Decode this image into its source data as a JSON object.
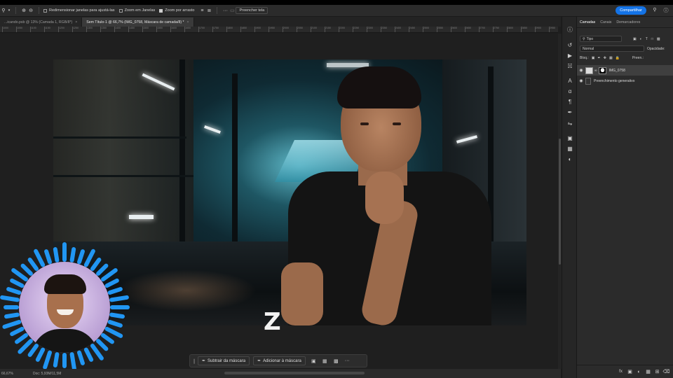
{
  "options_bar": {
    "checkbox_resize_label": "Redimensionar janelas para ajustá-las",
    "checkbox_zoom_all_label": "Zoom em Janelas",
    "checkbox_scrubby_label": "Zoom por arrasto",
    "fill_screen_label": "Preencher tela",
    "share_label": "Compartilhar"
  },
  "tabs": [
    {
      "label": "...icando.psb @ 13% (Camada 1, RGB/8*)",
      "close": "×"
    },
    {
      "label": "Sem Título-1 @ 66,7% (IMG_0758, Máscara de camada/8) *",
      "close": "×"
    }
  ],
  "ruler_ticks": [
    "1000",
    "1050",
    "1100",
    "1150",
    "1200",
    "1250",
    "1300",
    "1350",
    "1400",
    "1450",
    "1500",
    "1550",
    "1600",
    "1650",
    "1700",
    "1750",
    "1800",
    "1850",
    "1900",
    "1950",
    "2000",
    "2050",
    "2100",
    "2150",
    "2200",
    "2250",
    "2300",
    "2350",
    "2400",
    "2450",
    "2500",
    "2550",
    "2600",
    "2650",
    "2700",
    "2750",
    "2800",
    "2850",
    "2900",
    "2950"
  ],
  "overlay_letter": "Z",
  "task_bar": {
    "subtract_label": "Subtrair da máscara",
    "add_label": "Adicionar à máscara",
    "more": "···"
  },
  "status_bar": {
    "zoom": "66,67%",
    "doc_info": "Doc: 5,93M/11,5M"
  },
  "panel": {
    "tabs": [
      "Camadas",
      "Canais",
      "Demarcadores"
    ],
    "active_tab": "Camadas",
    "filter_label": "Tipo",
    "blend_mode": "Normal",
    "opacity_label": "Opacidade:",
    "lock_label": "Bloq.:",
    "fill_label": "Preen.:",
    "layers": [
      {
        "name": "IMG_0758",
        "selected": true
      },
      {
        "name": "Preenchimento generativo",
        "selected": false
      }
    ]
  },
  "colors": {
    "accent": "#1473e6",
    "avatar_ring": "#2196f3"
  }
}
